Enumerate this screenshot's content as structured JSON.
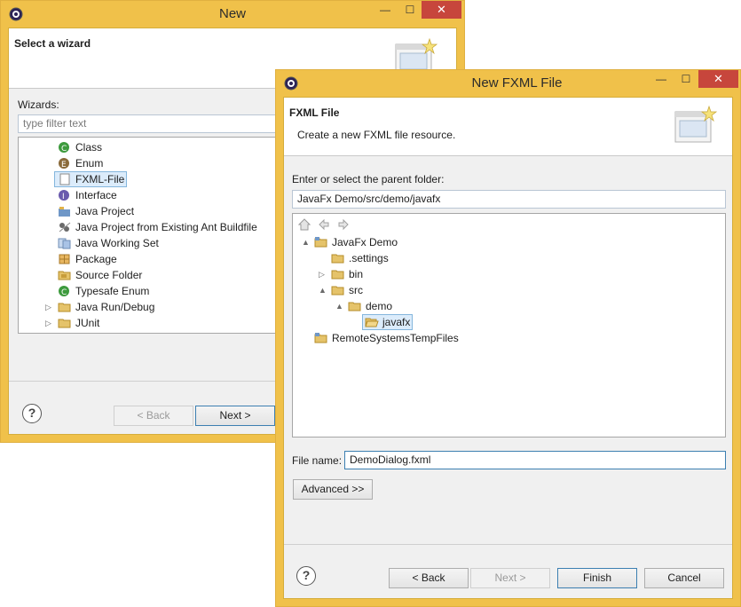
{
  "back_window": {
    "title": "New",
    "minimize": "—",
    "maximize": "☐",
    "close": "✕",
    "header": {
      "title": "Select a wizard"
    },
    "wizards_label": "Wizards:",
    "filter_placeholder": "type filter text",
    "wizard_items": [
      {
        "label": "Class",
        "icon": "class-icon"
      },
      {
        "label": "Enum",
        "icon": "enum-icon"
      },
      {
        "label": "FXML-File",
        "icon": "fxml-file-icon",
        "selected": true
      },
      {
        "label": "Interface",
        "icon": "interface-icon"
      },
      {
        "label": "Java Project",
        "icon": "java-project-icon"
      },
      {
        "label": "Java Project from Existing Ant Buildfile",
        "icon": "ant-project-icon"
      },
      {
        "label": "Java Working Set",
        "icon": "working-set-icon"
      },
      {
        "label": "Package",
        "icon": "package-icon"
      },
      {
        "label": "Source Folder",
        "icon": "source-folder-icon"
      },
      {
        "label": "Typesafe Enum",
        "icon": "typesafe-enum-icon"
      },
      {
        "label": "Java Run/Debug",
        "icon": "folder-icon",
        "expandable": true
      },
      {
        "label": "JUnit",
        "icon": "folder-icon",
        "expandable": true
      }
    ],
    "buttons": {
      "back": "< Back",
      "next": "Next >"
    }
  },
  "front_window": {
    "title": "New FXML File",
    "minimize": "—",
    "maximize": "☐",
    "close": "✕",
    "header": {
      "title": "FXML File",
      "description": "Create a new FXML file resource."
    },
    "parent_folder_label": "Enter or select the parent folder:",
    "parent_folder_value": "JavaFx Demo/src/demo/javafx",
    "tree": [
      {
        "label": "JavaFx Demo",
        "level": 0,
        "twisty": "▲",
        "icon": "project-folder-icon"
      },
      {
        "label": ".settings",
        "level": 1,
        "twisty": "",
        "icon": "folder-icon"
      },
      {
        "label": "bin",
        "level": 1,
        "twisty": "▷",
        "icon": "folder-icon"
      },
      {
        "label": "src",
        "level": 1,
        "twisty": "▲",
        "icon": "folder-icon"
      },
      {
        "label": "demo",
        "level": 2,
        "twisty": "▲",
        "icon": "folder-icon"
      },
      {
        "label": "javafx",
        "level": 3,
        "twisty": "",
        "icon": "folder-open-icon",
        "selected": true
      },
      {
        "label": "RemoteSystemsTempFiles",
        "level": 0,
        "twisty": "",
        "icon": "project-folder-icon"
      }
    ],
    "file_name_label": "File name:",
    "file_name_value": "DemoDialog.fxml",
    "advanced_button": "Advanced >>",
    "buttons": {
      "back": "< Back",
      "next": "Next >",
      "finish": "Finish",
      "cancel": "Cancel"
    }
  },
  "colors": {
    "window_frame": "#f0c14a",
    "close_button": "#c7463c",
    "selection": "#dcecfb",
    "selection_border": "#84b6dd"
  }
}
